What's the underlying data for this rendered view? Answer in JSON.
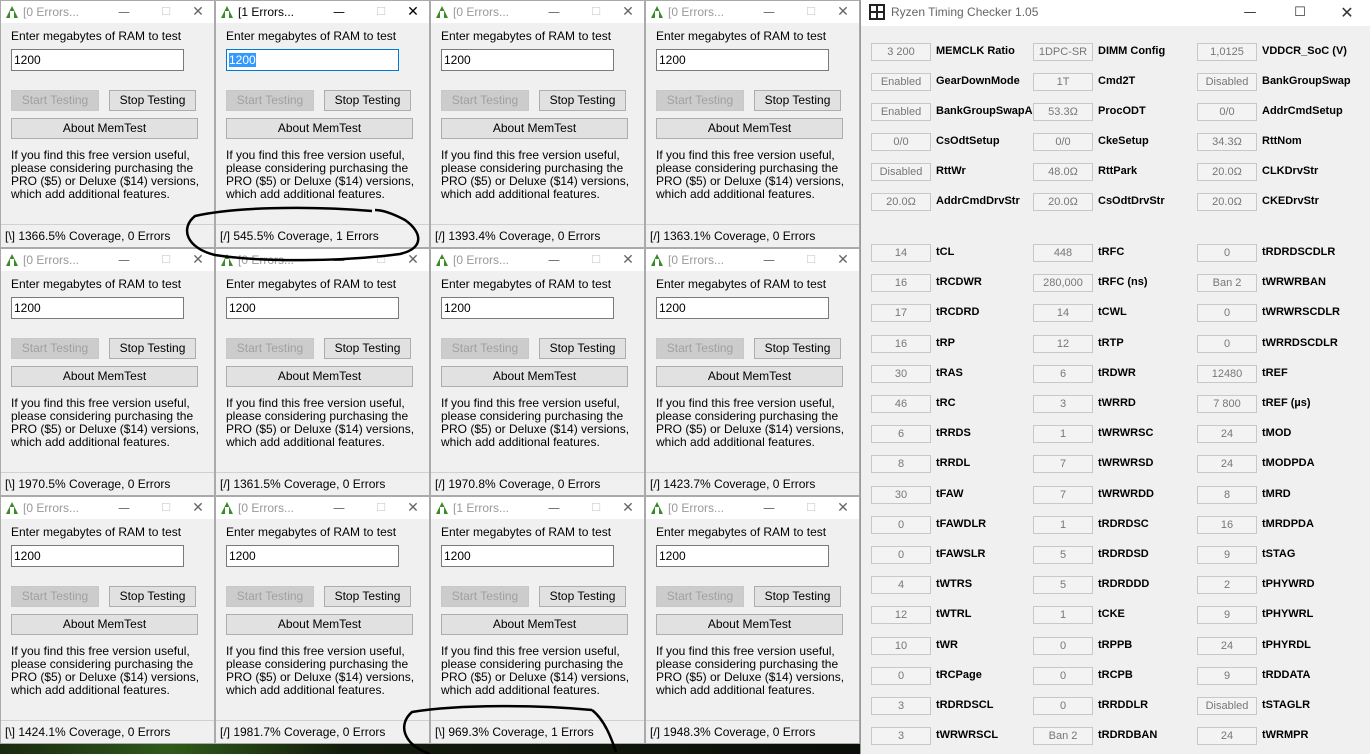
{
  "memtest": {
    "prompt": "Enter megabytes of RAM to test",
    "start_label": "Start Testing",
    "stop_label": "Stop Testing",
    "about_label": "About MemTest",
    "info_text": "If you find this free version useful, please considering purchasing the PRO ($5) or Deluxe ($14) versions, which add additional features.",
    "min_glyph": "—",
    "max_glyph": "☐",
    "close_glyph": "✕",
    "windows": [
      {
        "title": "[0 Errors...",
        "value": "1200",
        "status": "[\\]   1366.5% Coverage, 0 Errors"
      },
      {
        "title": "[1 Errors...",
        "value": "1200",
        "status": "[/]   545.5% Coverage, 1 Errors"
      },
      {
        "title": "[0 Errors...",
        "value": "1200",
        "status": "[/]   1393.4% Coverage, 0 Errors"
      },
      {
        "title": "[0 Errors...",
        "value": "1200",
        "status": "[/]   1363.1% Coverage, 0 Errors"
      },
      {
        "title": "[0 Errors...",
        "value": "1200",
        "status": "[\\]   1970.5% Coverage, 0 Errors"
      },
      {
        "title": "[0 Errors...",
        "value": "1200",
        "status": "[/]   1361.5% Coverage, 0 Errors"
      },
      {
        "title": "[0 Errors...",
        "value": "1200",
        "status": "[/]   1970.8% Coverage, 0 Errors"
      },
      {
        "title": "[0 Errors...",
        "value": "1200",
        "status": "[/]   1423.7% Coverage, 0 Errors"
      },
      {
        "title": "[0 Errors...",
        "value": "1200",
        "status": "[\\]   1424.1% Coverage, 0 Errors"
      },
      {
        "title": "[0 Errors...",
        "value": "1200",
        "status": "[/]   1981.7% Coverage, 0 Errors"
      },
      {
        "title": "[1 Errors...",
        "value": "1200",
        "status": "[\\]   969.3% Coverage, 1 Errors"
      },
      {
        "title": "[0 Errors...",
        "value": "1200",
        "status": "[/]   1948.3% Coverage, 0 Errors"
      }
    ],
    "active_index": 1
  },
  "rtc": {
    "title": "Ryzen Timing Checker 1.05",
    "min_glyph": "—",
    "max_glyph": "☐",
    "close_glyph": "✕",
    "top": [
      [
        {
          "v": "3 200",
          "l": "MEMCLK Ratio"
        },
        {
          "v": "1DPC-SR",
          "l": "DIMM Config"
        },
        {
          "v": "1,0125",
          "l": "VDDCR_SoC (V)"
        }
      ],
      [
        {
          "v": "Enabled",
          "l": "GearDownMode"
        },
        {
          "v": "1T",
          "l": "Cmd2T"
        },
        {
          "v": "Disabled",
          "l": "BankGroupSwap"
        }
      ],
      [
        {
          "v": "Enabled",
          "l": "BankGroupSwapAlt"
        },
        {
          "v": "53.3Ω",
          "l": "ProcODT"
        },
        {
          "v": "0/0",
          "l": "AddrCmdSetup"
        }
      ],
      [
        {
          "v": "0/0",
          "l": "CsOdtSetup"
        },
        {
          "v": "0/0",
          "l": "CkeSetup"
        },
        {
          "v": "34.3Ω",
          "l": "RttNom"
        }
      ],
      [
        {
          "v": "Disabled",
          "l": "RttWr"
        },
        {
          "v": "48.0Ω",
          "l": "RttPark"
        },
        {
          "v": "20.0Ω",
          "l": "CLKDrvStr"
        }
      ],
      [
        {
          "v": "20.0Ω",
          "l": "AddrCmdDrvStr"
        },
        {
          "v": "20.0Ω",
          "l": "CsOdtDrvStr"
        },
        {
          "v": "20.0Ω",
          "l": "CKEDrvStr"
        }
      ]
    ],
    "timings": [
      [
        {
          "v": "14",
          "l": "tCL"
        },
        {
          "v": "448",
          "l": "tRFC"
        },
        {
          "v": "0",
          "l": "tRDRDSCDLR"
        }
      ],
      [
        {
          "v": "16",
          "l": "tRCDWR"
        },
        {
          "v": "280,000",
          "l": "tRFC (ns)"
        },
        {
          "v": "Ban 2",
          "l": "tWRWRBAN"
        }
      ],
      [
        {
          "v": "17",
          "l": "tRCDRD"
        },
        {
          "v": "14",
          "l": "tCWL"
        },
        {
          "v": "0",
          "l": "tWRWRSCDLR"
        }
      ],
      [
        {
          "v": "16",
          "l": "tRP"
        },
        {
          "v": "12",
          "l": "tRTP"
        },
        {
          "v": "0",
          "l": "tWRRDSCDLR"
        }
      ],
      [
        {
          "v": "30",
          "l": "tRAS"
        },
        {
          "v": "6",
          "l": "tRDWR"
        },
        {
          "v": "12480",
          "l": "tREF"
        }
      ],
      [
        {
          "v": "46",
          "l": "tRC"
        },
        {
          "v": "3",
          "l": "tWRRD"
        },
        {
          "v": "7 800",
          "l": "tREF (µs)"
        }
      ],
      [
        {
          "v": "6",
          "l": "tRRDS"
        },
        {
          "v": "1",
          "l": "tWRWRSC"
        },
        {
          "v": "24",
          "l": "tMOD"
        }
      ],
      [
        {
          "v": "8",
          "l": "tRRDL"
        },
        {
          "v": "7",
          "l": "tWRWRSD"
        },
        {
          "v": "24",
          "l": "tMODPDA"
        }
      ],
      [
        {
          "v": "30",
          "l": "tFAW"
        },
        {
          "v": "7",
          "l": "tWRWRDD"
        },
        {
          "v": "8",
          "l": "tMRD"
        }
      ],
      [
        {
          "v": "0",
          "l": "tFAWDLR"
        },
        {
          "v": "1",
          "l": "tRDRDSC"
        },
        {
          "v": "16",
          "l": "tMRDPDA"
        }
      ],
      [
        {
          "v": "0",
          "l": "tFAWSLR"
        },
        {
          "v": "5",
          "l": "tRDRDSD"
        },
        {
          "v": "9",
          "l": "tSTAG"
        }
      ],
      [
        {
          "v": "4",
          "l": "tWTRS"
        },
        {
          "v": "5",
          "l": "tRDRDDD"
        },
        {
          "v": "2",
          "l": "tPHYWRD"
        }
      ],
      [
        {
          "v": "12",
          "l": "tWTRL"
        },
        {
          "v": "1",
          "l": "tCKE"
        },
        {
          "v": "9",
          "l": "tPHYWRL"
        }
      ],
      [
        {
          "v": "10",
          "l": "tWR"
        },
        {
          "v": "0",
          "l": "tRPPB"
        },
        {
          "v": "24",
          "l": "tPHYRDL"
        }
      ],
      [
        {
          "v": "0",
          "l": "tRCPage"
        },
        {
          "v": "0",
          "l": "tRCPB"
        },
        {
          "v": "9",
          "l": "tRDDATA"
        }
      ],
      [
        {
          "v": "3",
          "l": "tRDRDSCL"
        },
        {
          "v": "0",
          "l": "tRRDDLR"
        },
        {
          "v": "Disabled",
          "l": "tSTAGLR"
        }
      ],
      [
        {
          "v": "3",
          "l": "tWRWRSCL"
        },
        {
          "v": "Ban 2",
          "l": "tRDRDBAN"
        },
        {
          "v": "24",
          "l": "tWRMPR"
        }
      ]
    ]
  },
  "colors": {
    "annotation": "#000000",
    "memtest_icon": "#3a8a2a",
    "selection": "#3399ff"
  }
}
